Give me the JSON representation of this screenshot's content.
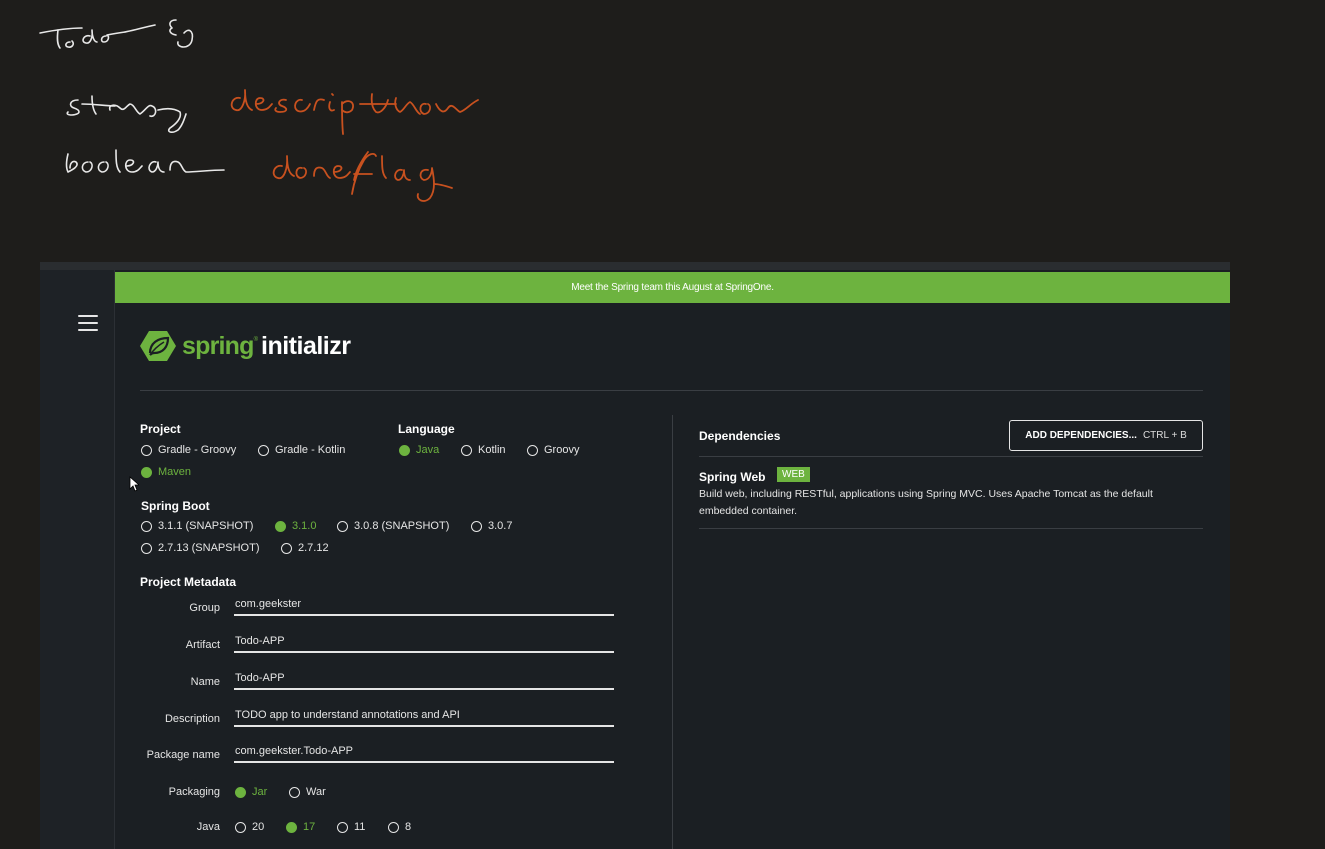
{
  "notes": {
    "line1": "Todo {}",
    "line2_type": "String",
    "line2_field": "description",
    "line3_type": "boolean",
    "line3_field": "done/flag"
  },
  "banner": {
    "text": "Meet the Spring team this August at SpringOne."
  },
  "logo": {
    "part1": "spring",
    "reg": "®",
    "part2": "initializr"
  },
  "project": {
    "title": "Project",
    "options": [
      {
        "label": "Gradle - Groovy",
        "selected": false
      },
      {
        "label": "Gradle - Kotlin",
        "selected": false
      },
      {
        "label": "Maven",
        "selected": true
      }
    ]
  },
  "language": {
    "title": "Language",
    "options": [
      {
        "label": "Java",
        "selected": true
      },
      {
        "label": "Kotlin",
        "selected": false
      },
      {
        "label": "Groovy",
        "selected": false
      }
    ]
  },
  "spring_boot": {
    "title": "Spring Boot",
    "options": [
      {
        "label": "3.1.1 (SNAPSHOT)",
        "selected": false
      },
      {
        "label": "3.1.0",
        "selected": true
      },
      {
        "label": "3.0.8 (SNAPSHOT)",
        "selected": false
      },
      {
        "label": "3.0.7",
        "selected": false
      },
      {
        "label": "2.7.13 (SNAPSHOT)",
        "selected": false
      },
      {
        "label": "2.7.12",
        "selected": false
      }
    ]
  },
  "metadata": {
    "title": "Project Metadata",
    "group": {
      "label": "Group",
      "value": "com.geekster"
    },
    "artifact": {
      "label": "Artifact",
      "value": "Todo-APP"
    },
    "name": {
      "label": "Name",
      "value": "Todo-APP"
    },
    "description": {
      "label": "Description",
      "value": "TODO app to understand annotations and API"
    },
    "package_name": {
      "label": "Package name",
      "value": "com.geekster.Todo-APP"
    },
    "packaging": {
      "label": "Packaging",
      "options": [
        {
          "label": "Jar",
          "selected": true
        },
        {
          "label": "War",
          "selected": false
        }
      ]
    },
    "java": {
      "label": "Java",
      "options": [
        {
          "label": "20",
          "selected": false
        },
        {
          "label": "17",
          "selected": true
        },
        {
          "label": "11",
          "selected": false
        },
        {
          "label": "8",
          "selected": false
        }
      ]
    }
  },
  "dependencies": {
    "title": "Dependencies",
    "add_button": "ADD DEPENDENCIES...",
    "add_shortcut": "CTRL + B",
    "items": [
      {
        "name": "Spring Web",
        "badge": "WEB",
        "description": "Build web, including RESTful, applications using Spring MVC. Uses Apache Tomcat as the default embedded container."
      }
    ]
  },
  "colors": {
    "accent": "#6db33f",
    "background": "#1b1f23",
    "ink_notes": "#e8e8e8",
    "ink_orange": "#c8511f"
  },
  "icons": {
    "menu": "hamburger-icon",
    "logo": "spring-leaf-icon",
    "cursor": "mouse-pointer-icon"
  }
}
